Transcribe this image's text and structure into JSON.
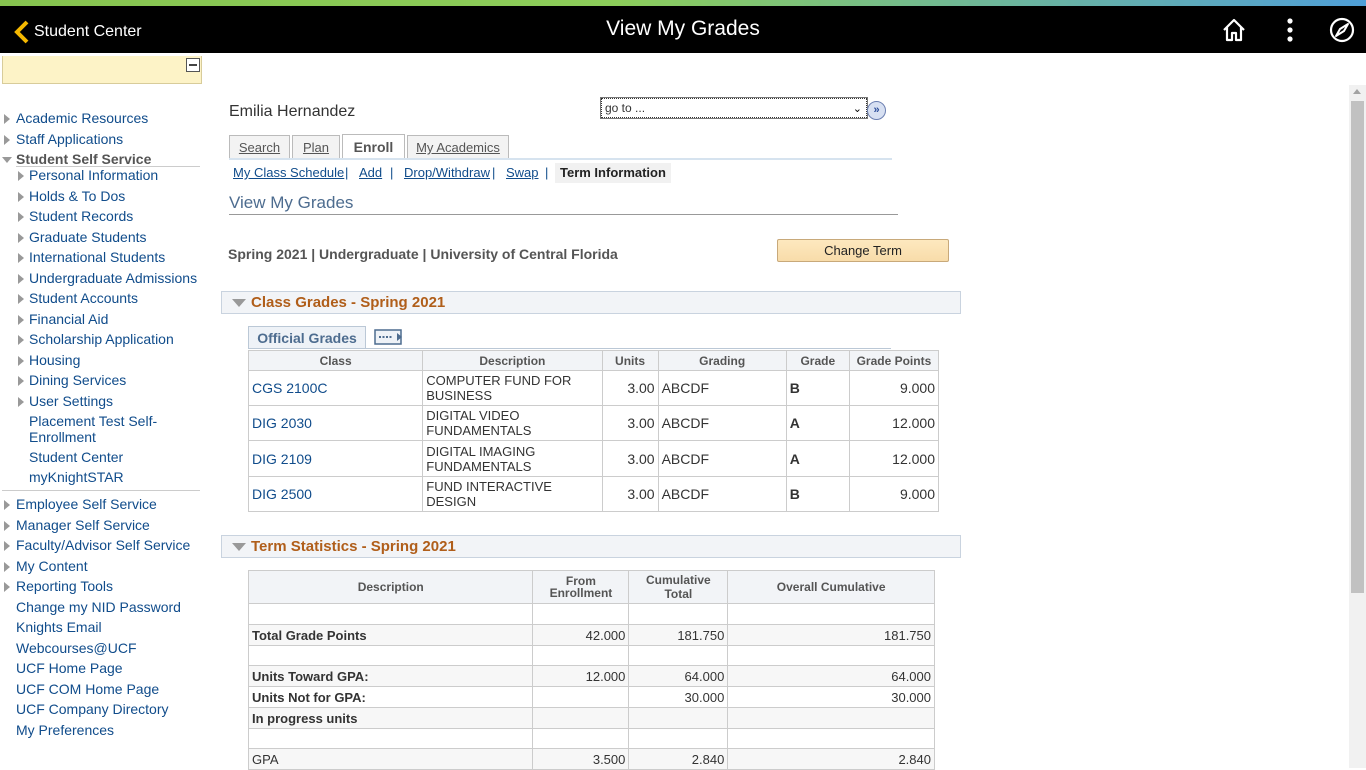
{
  "topbar": {
    "back_label": "Student Center",
    "title": "View My Grades"
  },
  "nav": {
    "items": [
      "Academic Resources",
      "Staff Applications",
      "Student Self Service",
      "Personal Information",
      "Holds & To Dos",
      "Student Records",
      "Graduate Students",
      "International Students",
      "Undergraduate Admissions",
      "Student Accounts",
      "Financial Aid",
      "Scholarship Application",
      "Housing",
      "Dining Services",
      "User Settings",
      "Placement Test Self-Enrollment",
      "Student Center",
      "myKnightSTAR",
      "Employee Self Service",
      "Manager Self Service",
      "Faculty/Advisor Self Service",
      "My Content",
      "Reporting Tools",
      "Change my NID Password",
      "Knights Email",
      "Webcourses@UCF",
      "UCF Home Page",
      "UCF COM Home Page",
      "UCF Company Directory",
      "My Preferences"
    ]
  },
  "main": {
    "student_name": "Emilia Hernandez",
    "goto_value": "go to ...",
    "tabs": [
      "Search",
      "Plan",
      "Enroll",
      "My Academics"
    ],
    "subnav": [
      "My Class Schedule",
      "Add",
      "Drop/Withdraw",
      "Swap",
      "Term Information"
    ],
    "subnav_sep": "|",
    "section_title": "View My Grades",
    "term_line": "Spring 2021 | Undergraduate | University of Central Florida",
    "change_term_label": "Change Term",
    "class_grades_title": "Class Grades - Spring 2021",
    "official_grades_tab": "Official Grades",
    "grades": {
      "columns": [
        "Class",
        "Description",
        "Units",
        "Grading",
        "Grade",
        "Grade Points"
      ],
      "rows": [
        {
          "class": "CGS 2100C",
          "description": "COMPUTER FUND FOR BUSINESS",
          "units": "3.00",
          "grading": "ABCDF",
          "grade": "B",
          "points": "9.000"
        },
        {
          "class": "DIG 2030",
          "description": "DIGITAL VIDEO FUNDAMENTALS",
          "units": "3.00",
          "grading": "ABCDF",
          "grade": "A",
          "points": "12.000"
        },
        {
          "class": "DIG 2109",
          "description": "DIGITAL IMAGING FUNDAMENTALS",
          "units": "3.00",
          "grading": "ABCDF",
          "grade": "A",
          "points": "12.000"
        },
        {
          "class": "DIG 2500",
          "description": "FUND INTERACTIVE DESIGN",
          "units": "3.00",
          "grading": "ABCDF",
          "grade": "B",
          "points": "9.000"
        }
      ]
    },
    "term_stats_title": "Term Statistics - Spring 2021",
    "stats": {
      "columns": [
        "Description",
        "From Enrollment",
        "Cumulative Total",
        "Overall Cumulative"
      ],
      "rows": [
        {
          "label": "",
          "from": "",
          "cum": "",
          "overall": ""
        },
        {
          "label": "Total Grade Points",
          "from": "42.000",
          "cum": "181.750",
          "overall": "181.750"
        },
        {
          "label": "",
          "from": "",
          "cum": "",
          "overall": ""
        },
        {
          "label": "Units Toward GPA:",
          "from": "12.000",
          "cum": "64.000",
          "overall": "64.000"
        },
        {
          "label": "Units Not for GPA:",
          "from": "",
          "cum": "30.000",
          "overall": "30.000"
        },
        {
          "label": "In progress units",
          "from": "",
          "cum": "",
          "overall": ""
        },
        {
          "label": "",
          "from": "",
          "cum": "",
          "overall": ""
        },
        {
          "label": "GPA",
          "from": "3.500",
          "cum": "2.840",
          "overall": "2.840"
        }
      ]
    }
  }
}
